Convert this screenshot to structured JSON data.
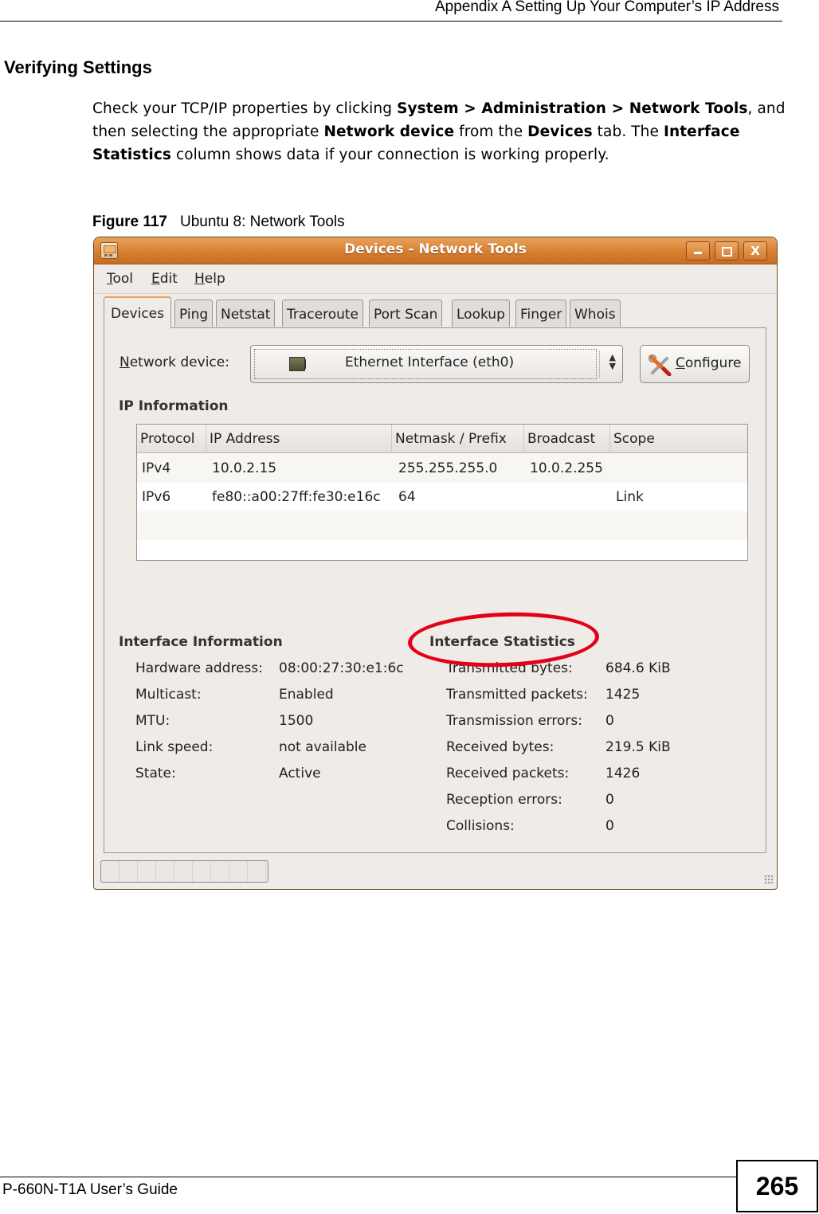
{
  "header": {
    "title": "Appendix A Setting Up Your Computer’s IP Address"
  },
  "section": {
    "title": "Verifying Settings"
  },
  "paragraph": {
    "t1": "Check your TCP/IP properties by clicking ",
    "b1": "System > Administration > Network Tools",
    "t2": ", and then selecting the appropriate ",
    "b2": "Network device",
    "t3": " from the ",
    "b3": "Devices",
    "t4": " tab.  The ",
    "b4": "Interface Statistics",
    "t5": " column shows data if your connection is working properly."
  },
  "figure": {
    "number": "Figure 117",
    "caption": "Ubuntu 8: Network Tools"
  },
  "window": {
    "title": "Devices - Network Tools",
    "icons": {
      "app": "network-tools-icon",
      "minimize": "minimize-icon",
      "maximize": "maximize-icon",
      "close": "close-icon"
    },
    "close_glyph": "X",
    "menu": [
      {
        "mnemonic": "T",
        "rest": "ool"
      },
      {
        "mnemonic": "E",
        "rest": "dit"
      },
      {
        "mnemonic": "H",
        "rest": "elp"
      }
    ],
    "tabs": [
      {
        "label": "Devices",
        "active": true
      },
      {
        "label": "Ping"
      },
      {
        "label": "Netstat"
      },
      {
        "label": "Traceroute"
      },
      {
        "label": "Port Scan"
      },
      {
        "label": "Lookup"
      },
      {
        "label": "Finger"
      },
      {
        "label": "Whois"
      }
    ],
    "device": {
      "label_mnemonic": "N",
      "label_rest": "etwork device:",
      "selected": "Ethernet Interface (eth0)",
      "arrows": "▲▼",
      "configure_mnemonic": "C",
      "configure_rest": "onfigure"
    },
    "ip_info": {
      "title": "IP Information",
      "columns": [
        "Protocol",
        "IP Address",
        "Netmask / Prefix",
        "Broadcast",
        "Scope"
      ],
      "rows": [
        [
          "IPv4",
          "10.0.2.15",
          "255.255.255.0",
          "10.0.2.255",
          ""
        ],
        [
          "IPv6",
          "fe80::a00:27ff:fe30:e16c",
          "64",
          "",
          "Link"
        ]
      ]
    },
    "interface_info": {
      "title": "Interface Information",
      "items": [
        {
          "label": "Hardware address:",
          "value": "08:00:27:30:e1:6c"
        },
        {
          "label": "Multicast:",
          "value": "Enabled"
        },
        {
          "label": "MTU:",
          "value": "1500"
        },
        {
          "label": "Link speed:",
          "value": "not available"
        },
        {
          "label": "State:",
          "value": "Active"
        }
      ]
    },
    "interface_stats": {
      "title": "Interface Statistics",
      "highlight_color": "#e4001b",
      "items": [
        {
          "label": "Transmitted bytes:",
          "value": "684.6 KiB"
        },
        {
          "label": "Transmitted packets:",
          "value": "1425"
        },
        {
          "label": "Transmission errors:",
          "value": "0"
        },
        {
          "label": "Received bytes:",
          "value": "219.5 KiB"
        },
        {
          "label": "Received packets:",
          "value": "1426"
        },
        {
          "label": "Reception errors:",
          "value": "0"
        },
        {
          "label": "Collisions:",
          "value": "0"
        }
      ]
    }
  },
  "footer": {
    "guide": "P-660N-T1A User’s Guide",
    "page": "265"
  }
}
